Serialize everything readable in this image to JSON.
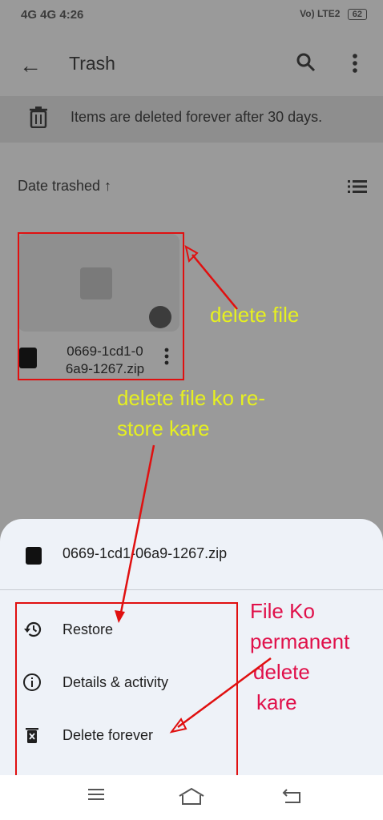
{
  "status_bar": {
    "left": "4G 4G 4:26",
    "right": "Vo) LTE2",
    "battery": "62"
  },
  "app_bar": {
    "title": "Trash"
  },
  "notice": {
    "text": "Items are deleted forever after 30 days."
  },
  "sort": {
    "label": "Date trashed ↑"
  },
  "file": {
    "name_line1": "0669-1cd1-0",
    "name_line2": "6a9-1267.zip",
    "full_name": "0669-1cd1-06a9-1267.zip"
  },
  "menu": {
    "items": [
      {
        "label": "Restore",
        "icon": "restore-icon"
      },
      {
        "label": "Details & activity",
        "icon": "info-icon"
      },
      {
        "label": "Delete forever",
        "icon": "delete-forever-icon"
      }
    ]
  },
  "annotations": {
    "delete_file": "delete file",
    "restore_line1": "delete file ko re-",
    "restore_line2": "store kare",
    "perm_line1": "File Ko",
    "perm_line2": "permanent",
    "perm_line3": "delete",
    "perm_line4": "kare"
  },
  "colors": {
    "scrim": "#9a9a9a",
    "sheet": "#eef2f8",
    "annotation_yellow": "#e6f020",
    "annotation_red": "#e0104a",
    "box_red": "#e01010"
  }
}
